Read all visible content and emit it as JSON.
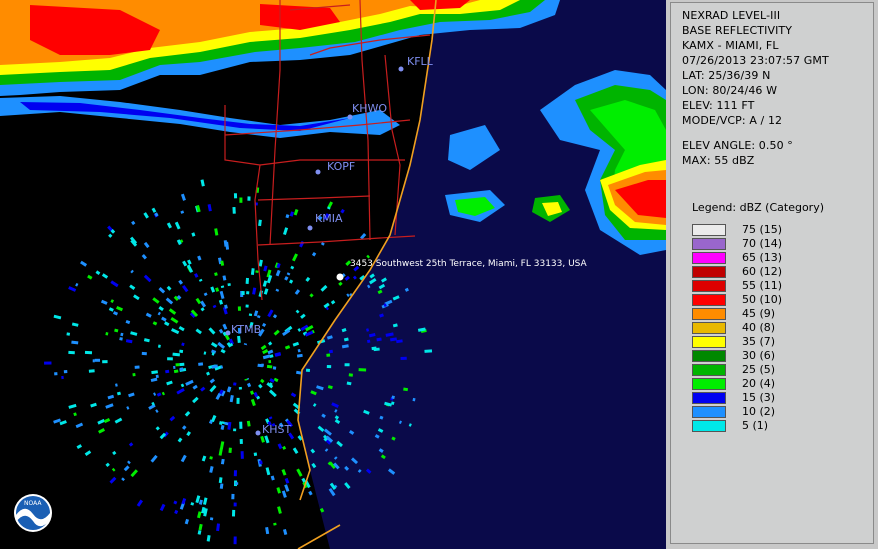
{
  "info": {
    "line1": "NEXRAD LEVEL-III",
    "line2": "BASE REFLECTIVITY",
    "station": "KAMX - MIAMI, FL",
    "datetime": "07/26/2013 23:07:57 GMT",
    "lat": "LAT: 25/36/39 N",
    "lon": "LON: 80/24/46 W",
    "elev": "ELEV: 111 FT",
    "mode": "MODE/VCP: A / 12",
    "elev_angle": "ELEV ANGLE: 0.50 °",
    "max": "MAX: 55 dBZ"
  },
  "legend": {
    "title": "Legend: dBZ (Category)",
    "items": [
      {
        "label": "75  (15)",
        "color": "#ebebeb"
      },
      {
        "label": "70  (14)",
        "color": "#9966cc"
      },
      {
        "label": "65  (13)",
        "color": "#ff00ff"
      },
      {
        "label": "60  (12)",
        "color": "#c00000"
      },
      {
        "label": "55  (11)",
        "color": "#dd0000"
      },
      {
        "label": "50  (10)",
        "color": "#ff0000"
      },
      {
        "label": "45  (9)",
        "color": "#ff8c00"
      },
      {
        "label": "40  (8)",
        "color": "#e8b800"
      },
      {
        "label": "35  (7)",
        "color": "#ffff00"
      },
      {
        "label": "30  (6)",
        "color": "#008800"
      },
      {
        "label": "25  (5)",
        "color": "#00b400"
      },
      {
        "label": "20  (4)",
        "color": "#00ee00"
      },
      {
        "label": "15  (3)",
        "color": "#0000f0"
      },
      {
        "label": "10  (2)",
        "color": "#1e90ff"
      },
      {
        "label": "5  (1)",
        "color": "#00e8e8"
      }
    ]
  },
  "stations": {
    "kfll": "KFLL",
    "khwo": "KHWO",
    "kopf": "KOPF",
    "kmia": "KMIA",
    "ktmb": "KTMB",
    "khst": "KHST"
  },
  "address": "3453 Southwest 25th Terrace, Miami, FL 33133, USA",
  "logo": "NOAA"
}
